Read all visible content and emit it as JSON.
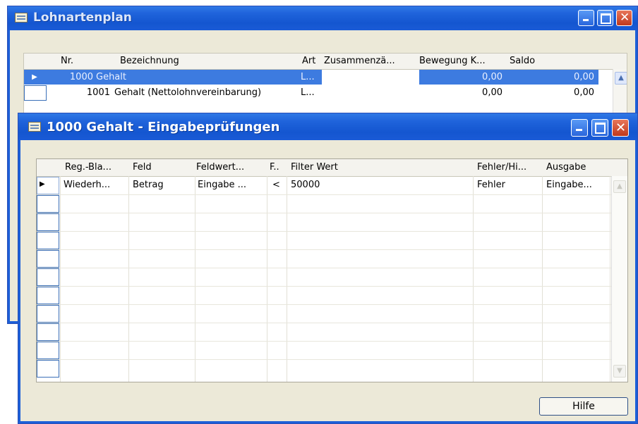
{
  "back_window": {
    "title": "Lohnartenplan",
    "columns": [
      "Nr.",
      "Bezeichnung",
      "Art",
      "Zusammenzä...",
      "Bewegung K...",
      "Saldo"
    ],
    "rows": [
      {
        "nr": "1000",
        "bezeichnung": "Gehalt",
        "art": "L...",
        "bewegung": "0,00",
        "saldo": "0,00",
        "selected": true
      },
      {
        "nr": "1001",
        "bezeichnung": "Gehalt (Nettolohnvereinbarung)",
        "art": "L...",
        "bewegung": "0,00",
        "saldo": "0,00",
        "selected": false
      }
    ]
  },
  "front_window": {
    "title": "1000 Gehalt - Eingabeprüfungen",
    "columns": [
      "Reg.-Bla...",
      "Feld",
      "Feldwert...",
      "F..",
      "Filter Wert",
      "Fehler/Hi...",
      "Ausgabe"
    ],
    "rows": [
      {
        "reg": "Wiederh...",
        "feld": "Betrag",
        "feldwert": "Eingabe ...",
        "f": "<",
        "filter": "50000",
        "fehler": "Fehler",
        "ausgabe": "Eingabe..."
      }
    ],
    "help_button": "Hilfe"
  },
  "colors": {
    "titlebar": "#1f63db",
    "selection": "#3d7be0",
    "window_bg": "#ece9d8"
  }
}
